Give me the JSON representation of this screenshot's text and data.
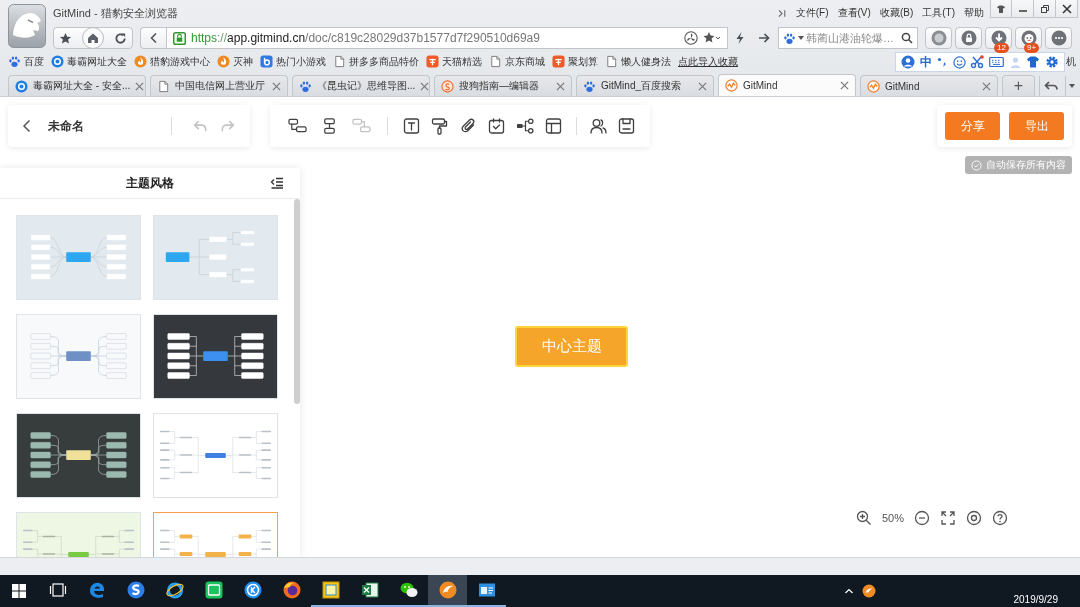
{
  "browser": {
    "title": "GitMind - 猎豹安全浏览器",
    "menu": [
      "文件(F)",
      "查看(V)",
      "收藏(B)",
      "工具(T)",
      "帮助"
    ],
    "url": [
      {
        "kind": "scheme",
        "text": "https"
      },
      {
        "kind": "separator",
        "text": "://"
      },
      {
        "kind": "host",
        "text": "app.gitmind.cn"
      },
      {
        "kind": "path",
        "text": "/doc/c819c28029d37b1577d7f290510d69a9"
      }
    ],
    "search": {
      "placeholder": "韩蔺山港油轮爆…"
    },
    "extensions": [
      {
        "kind": "k"
      },
      {
        "kind": "lock"
      },
      {
        "kind": "download",
        "badge": "12"
      },
      {
        "kind": "game",
        "badge": "9+"
      },
      {
        "kind": "more"
      }
    ]
  },
  "bookmarks": [
    {
      "label": "百度",
      "kind": "paw"
    },
    {
      "label": "毒霸网址大全",
      "kind": "k"
    },
    {
      "label": "猎豹游戏中心",
      "kind": "fire"
    },
    {
      "label": "灭神",
      "kind": "fire"
    },
    {
      "label": "热门小游戏",
      "kind": "b"
    },
    {
      "label": "拼多多商品特价",
      "kind": "page"
    },
    {
      "label": "天猫精选",
      "kind": "tao"
    },
    {
      "label": "京东商城",
      "kind": "page"
    },
    {
      "label": "聚划算",
      "kind": "tao"
    },
    {
      "label": "懒人健身法",
      "kind": "page"
    },
    {
      "label": "点此导入收藏",
      "kind": "link"
    }
  ],
  "bookmark_overflow": "机",
  "ime": {
    "label": "中"
  },
  "tabs": [
    {
      "label": "毒霸网址大全 - 安全...",
      "kind": "k",
      "selected": false
    },
    {
      "label": "中国电信网上营业厅",
      "kind": "page",
      "selected": false
    },
    {
      "label": "《昆虫记》思维导图...",
      "kind": "paw",
      "selected": false
    },
    {
      "label": "搜狗指南—编辑器",
      "kind": "sogou",
      "selected": false
    },
    {
      "label": "GitMind_百度搜索",
      "kind": "paw",
      "selected": false
    },
    {
      "label": "GitMind",
      "kind": "gitmind",
      "selected": true
    },
    {
      "label": "GitMind",
      "kind": "gitmind",
      "selected": false
    }
  ],
  "new_tab": "+",
  "editor": {
    "doc_title": "未命名",
    "undo": {
      "disabled": true
    },
    "redo": {
      "disabled": true
    },
    "tool_groups": [
      [
        {
          "kind": "add-child",
          "disabled": false
        },
        {
          "kind": "add-sibling",
          "disabled": false
        },
        {
          "kind": "add-parent",
          "disabled": true
        }
      ],
      [
        {
          "kind": "text",
          "disabled": false
        },
        {
          "kind": "format-painter",
          "disabled": false
        },
        {
          "kind": "attachment",
          "disabled": false
        },
        {
          "kind": "task",
          "disabled": false
        },
        {
          "kind": "relation",
          "disabled": false
        },
        {
          "kind": "layout",
          "disabled": false
        }
      ],
      [
        {
          "kind": "collaborate",
          "disabled": false
        },
        {
          "kind": "save",
          "disabled": false
        }
      ]
    ],
    "actions": [
      {
        "label": "分享"
      },
      {
        "label": "导出"
      }
    ],
    "autosave": "自动保存所有内容",
    "theme_panel": {
      "title": "主题风格",
      "themes": [
        {
          "kind": "classic",
          "selected": false
        },
        {
          "kind": "tree",
          "selected": false
        },
        {
          "kind": "curved-light",
          "selected": false
        },
        {
          "kind": "dark-blue",
          "selected": false
        },
        {
          "kind": "dark-green",
          "selected": false
        },
        {
          "kind": "white-blue",
          "selected": false
        },
        {
          "kind": "green",
          "selected": false
        },
        {
          "kind": "orange",
          "selected": true
        }
      ]
    },
    "center_node": "中心主题",
    "zoom_level": "50%"
  },
  "taskbar": {
    "apps": [
      {
        "kind": "task-view",
        "running": false,
        "selected": false
      },
      {
        "kind": "edge",
        "running": false,
        "selected": false
      },
      {
        "kind": "sogou-browser",
        "running": false,
        "selected": false
      },
      {
        "kind": "ie",
        "running": false,
        "selected": false
      },
      {
        "kind": "iqiyi",
        "running": false,
        "selected": false
      },
      {
        "kind": "kugou",
        "running": false,
        "selected": false
      },
      {
        "kind": "firefox",
        "running": false,
        "selected": false
      },
      {
        "kind": "notepad",
        "running": true,
        "selected": false
      },
      {
        "kind": "excel",
        "running": true,
        "selected": false
      },
      {
        "kind": "wechat",
        "running": true,
        "selected": false
      },
      {
        "kind": "cheetah",
        "running": true,
        "selected": true
      },
      {
        "kind": "app-window",
        "running": true,
        "selected": false
      }
    ],
    "date": "2019/9/29"
  }
}
